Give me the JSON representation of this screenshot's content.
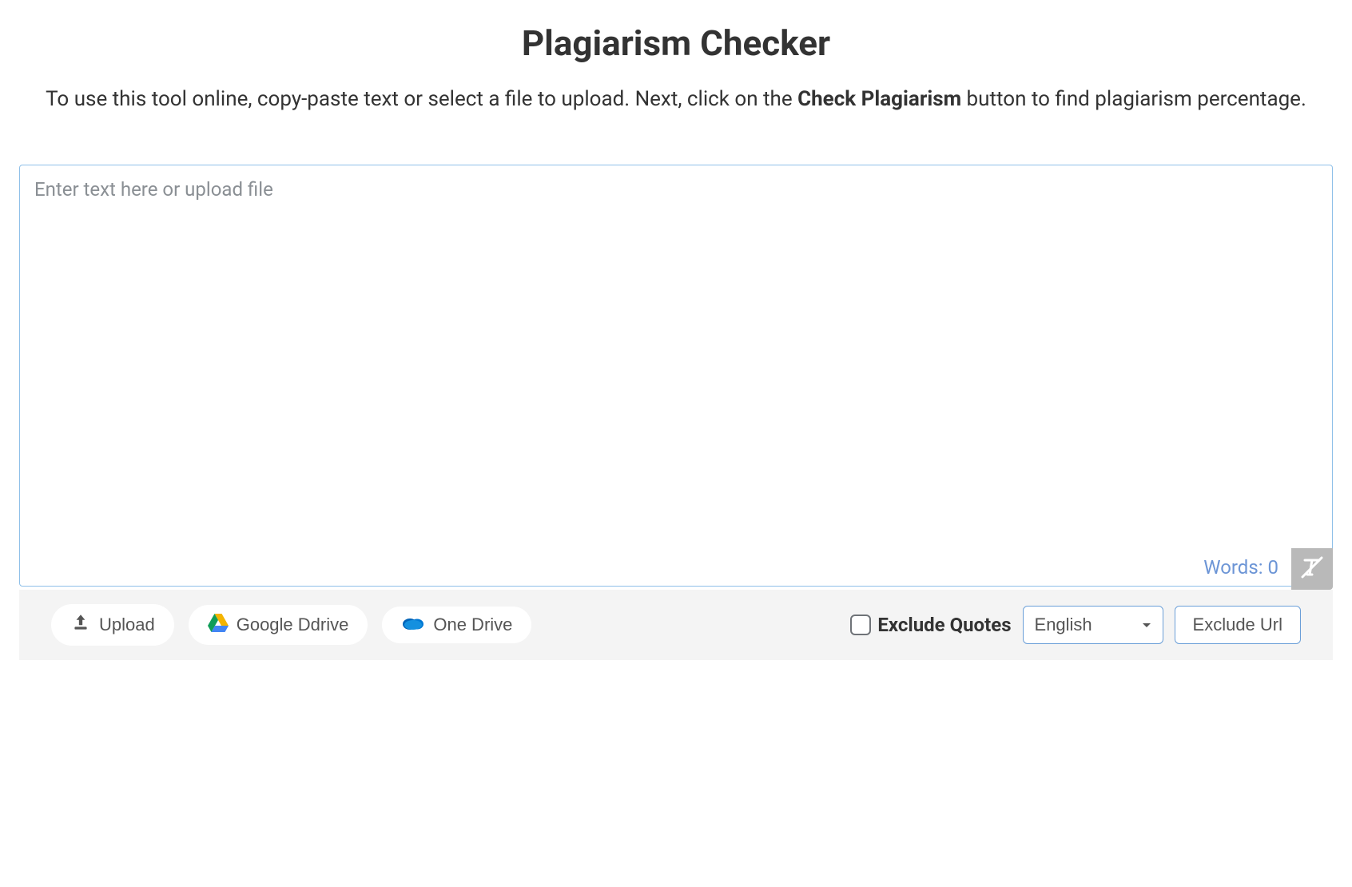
{
  "header": {
    "title": "Plagiarism Checker",
    "desc_prefix": "To use this tool online, copy-paste text or select a file to upload. Next, click on the ",
    "desc_bold": "Check Plagiarism",
    "desc_suffix": " button to find plagiarism percentage."
  },
  "editor": {
    "placeholder": "Enter text here or upload file",
    "value": "",
    "words_label": "Words: ",
    "words_count": "0"
  },
  "toolbar": {
    "upload_label": "Upload",
    "gdrive_label": "Google Ddrive",
    "onedrive_label": "One Drive",
    "exclude_quotes_label": "Exclude Quotes",
    "language_selected": "English",
    "exclude_url_label": "Exclude Url"
  }
}
